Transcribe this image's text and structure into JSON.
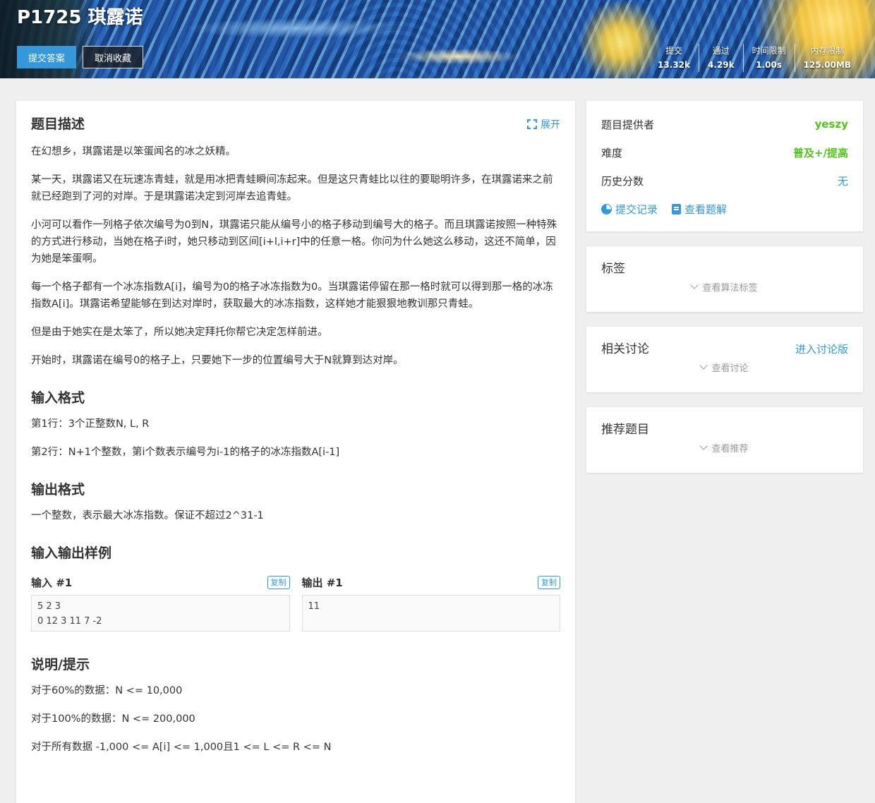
{
  "banner": {
    "title": "P1725 琪露诺",
    "submit_label": "提交答案",
    "unfav_label": "取消收藏",
    "stats": [
      {
        "label": "提交",
        "value": "13.32k"
      },
      {
        "label": "通过",
        "value": "4.29k"
      },
      {
        "label": "时间限制",
        "value": "1.00s"
      },
      {
        "label": "内存限制",
        "value": "125.00MB"
      }
    ]
  },
  "problem": {
    "desc_title": "题目描述",
    "expand_label": "展开",
    "desc_paras": [
      "在幻想乡，琪露诺是以笨蛋闻名的冰之妖精。",
      "某一天，琪露诺又在玩速冻青蛙，就是用冰把青蛙瞬间冻起来。但是这只青蛙比以往的要聪明许多，在琪露诺来之前就已经跑到了河的对岸。于是琪露诺决定到河岸去追青蛙。",
      "小河可以看作一列格子依次编号为0到N，琪露诺只能从编号小的格子移动到编号大的格子。而且琪露诺按照一种特殊的方式进行移动，当她在格子i时，她只移动到区间[i+l,i+r]中的任意一格。你问为什么她这么移动，这还不简单，因为她是笨蛋啊。",
      "每一个格子都有一个冰冻指数A[i]，编号为0的格子冰冻指数为0。当琪露诺停留在那一格时就可以得到那一格的冰冻指数A[i]。琪露诺希望能够在到达对岸时，获取最大的冰冻指数，这样她才能狠狠地教训那只青蛙。",
      "但是由于她实在是太笨了，所以她决定拜托你帮它决定怎样前进。",
      "开始时，琪露诺在编号0的格子上，只要她下一步的位置编号大于N就算到达对岸。"
    ],
    "input_title": "输入格式",
    "input_paras": [
      "第1行：3个正整数N, L, R",
      "第2行：N+1个整数，第i个数表示编号为i-1的格子的冰冻指数A[i-1]"
    ],
    "output_title": "输出格式",
    "output_paras": [
      "一个整数，表示最大冰冻指数。保证不超过2^31-1"
    ],
    "samples_title": "输入输出样例",
    "sample_input_title": "输入 #1",
    "sample_output_title": "输出 #1",
    "copy_label": "复制",
    "sample_input": "5 2 3\n0 12 3 11 7 -2",
    "sample_output": "11",
    "hint_title": "说明/提示",
    "hint_paras": [
      "对于60%的数据：N <= 10,000",
      "对于100%的数据：N <= 200,000",
      "对于所有数据 -1,000 <= A[i] <= 1,000且1 <= L <= R <= N"
    ]
  },
  "sidebar": {
    "provider_label": "题目提供者",
    "provider_value": "yeszy",
    "difficulty_label": "难度",
    "difficulty_value": "普及+/提高",
    "history_label": "历史分数",
    "history_value": "无",
    "records_link": "提交记录",
    "solutions_link": "查看题解",
    "tags_title": "标签",
    "tags_toggle": "查看算法标签",
    "discuss_title": "相关讨论",
    "discuss_link": "进入讨论版",
    "discuss_toggle": "查看讨论",
    "recommend_title": "推荐题目",
    "recommend_toggle": "查看推荐"
  },
  "colors": {
    "accent": "#3498db",
    "green": "#52c41a",
    "background": "#efefef"
  }
}
